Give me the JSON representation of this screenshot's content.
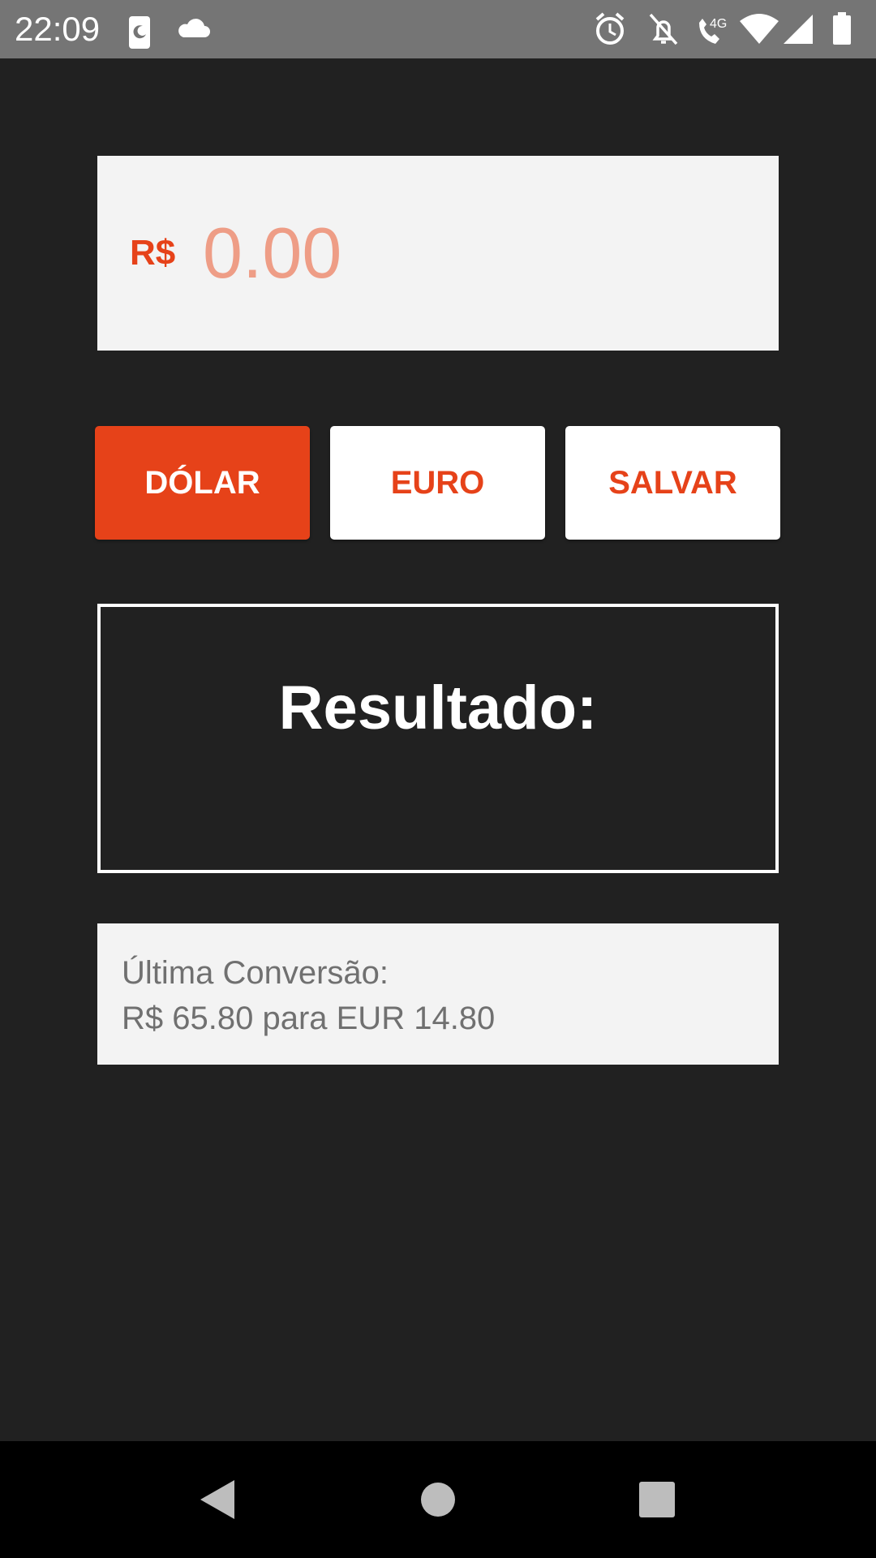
{
  "status_bar": {
    "time": "22:09",
    "left_icons": [
      "phone-moon-icon",
      "cloud-icon"
    ],
    "right_icons": [
      "alarm-icon",
      "notifications-off-icon",
      "volte-4g-call-icon",
      "wifi-icon",
      "cell-signal-icon",
      "battery-icon"
    ],
    "network_label": "4G"
  },
  "amount_input": {
    "currency_prefix": "R$",
    "placeholder": "0.00",
    "value": ""
  },
  "buttons": {
    "dolar": "DÓLAR",
    "euro": "EURO",
    "salvar": "SALVAR"
  },
  "result": {
    "title": "Resultado:",
    "value": ""
  },
  "last_conversion": {
    "label": "Última Conversão:",
    "value": "R$ 65.80 para EUR 14.80"
  },
  "nav_bar": {
    "buttons": [
      "back-icon",
      "home-icon",
      "recents-icon"
    ]
  },
  "colors": {
    "accent": "#e64219",
    "background": "#212121",
    "input_background": "#f3f3f3",
    "status_bar": "#757575",
    "nav_bar": "#000000"
  }
}
